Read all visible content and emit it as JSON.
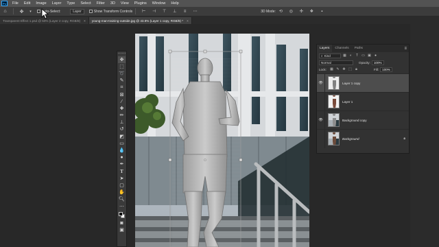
{
  "menubar": {
    "items": [
      "File",
      "Edit",
      "Image",
      "Layer",
      "Type",
      "Select",
      "Filter",
      "3D",
      "View",
      "Plugins",
      "Window",
      "Help"
    ]
  },
  "options": {
    "auto_select": "Auto-Select:",
    "layer_dropdown": "Layer",
    "show_transform": "Show Transform Controls",
    "mode_3d": "3D Mode:"
  },
  "tabs": [
    {
      "label": "Transparent Effect 1.psd @ 50% (Layer 2 copy, RGB/8)",
      "active": false
    },
    {
      "label": "young-man-training-outside.jpg @ 43.8% (Layer 1 copy, RGB/8) *",
      "active": true
    }
  ],
  "layers_panel": {
    "tabs": [
      "Layers",
      "Channels",
      "Paths"
    ],
    "filter_kind": "Kind",
    "blend_mode": "Normal",
    "opacity_label": "Opacity:",
    "opacity_value": "100%",
    "lock_label": "Lock:",
    "fill_label": "Fill:",
    "fill_value": "100%",
    "layers": [
      {
        "name": "Layer 1 copy",
        "visible": true,
        "selected": true,
        "italic": false,
        "locked": false
      },
      {
        "name": "Layer 1",
        "visible": false,
        "selected": false,
        "italic": false,
        "locked": false
      },
      {
        "name": "Background copy",
        "visible": true,
        "selected": false,
        "italic": false,
        "locked": false
      },
      {
        "name": "Background",
        "visible": false,
        "selected": false,
        "italic": true,
        "locked": true
      }
    ]
  },
  "colors": {
    "foreground": "#000000",
    "background": "#ffffff",
    "accent": "#31a8ff"
  }
}
